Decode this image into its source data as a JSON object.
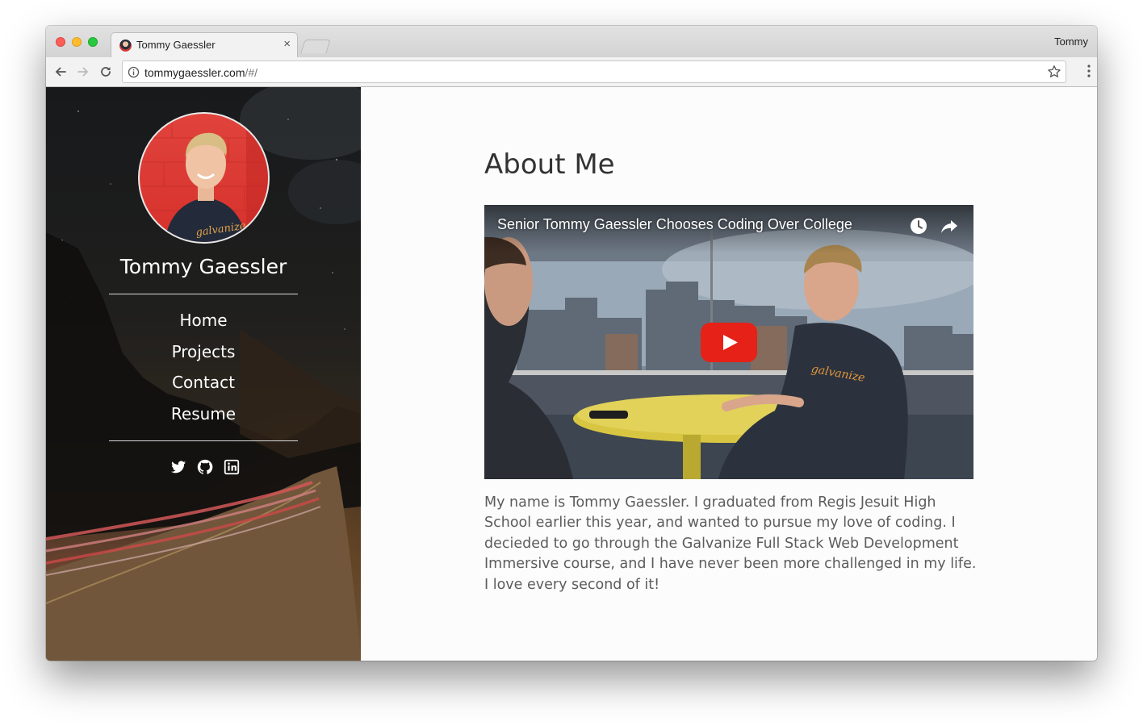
{
  "browser": {
    "tab_title": "Tommy Gaessler",
    "tab_close": "×",
    "profile_name": "Tommy",
    "url_host": "tommygaessler.com",
    "url_path": "/#/"
  },
  "sidebar": {
    "name": "Tommy Gaessler",
    "nav": [
      "Home",
      "Projects",
      "Contact",
      "Resume"
    ],
    "social_icons": [
      "twitter-icon",
      "github-icon",
      "linkedin-icon"
    ]
  },
  "main": {
    "heading": "About Me",
    "video": {
      "title": "Senior Tommy Gaessler Chooses Coding Over College",
      "shirt_text": "galvanize"
    },
    "bio": "My name is Tommy Gaessler. I graduated from Regis Jesuit High School earlier this year, and wanted to pursue my love of coding. I decieded to go through the Galvanize Full Stack Web Development Immersive course, and I have never been more challenged in my life. I love every second of it!"
  },
  "colors": {
    "accent_red": "#e62117",
    "sidebar_text": "#ffffff",
    "heading": "#333333",
    "body_text": "#5c5c5c"
  }
}
